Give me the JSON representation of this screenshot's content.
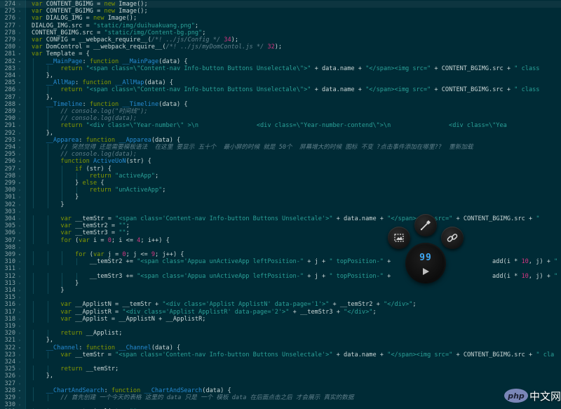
{
  "editor": {
    "lines": [
      {
        "n": "274",
        "code": "var CONTENT_BGIMG = new Image();",
        "current": true
      },
      {
        "n": "275",
        "code": "var CONTENT_BGIMG = new Image();"
      },
      {
        "n": "276",
        "code": "var DIALOG_IMG = new Image();"
      },
      {
        "n": "277",
        "code": "DIALOG_IMG.src = \"static/img/duihuakuang.png\";"
      },
      {
        "n": "278",
        "code": "CONTENT_BGIMG.src = \"static/img/Content-bg.png\";"
      },
      {
        "n": "279",
        "code": "var CONFIG = __webpack_require__(/*! ../js/Config */ 34);"
      },
      {
        "n": "280",
        "code": "var DomControl = __webpack_require__(/*! ../js/myDomContol.js */ 32);"
      },
      {
        "n": "281",
        "code": "var Template = {"
      },
      {
        "n": "282",
        "code": "    __MainPage: function __MainPage(data) {"
      },
      {
        "n": "283",
        "code": "        return \"<span class=\\\"Content-nav Info-button Buttons Unselectale\\\">\" + data.name + \"</span><img src=\" + CONTENT_BGIMG.src + \" class"
      },
      {
        "n": "284",
        "code": "    },"
      },
      {
        "n": "285",
        "code": "    __AllMap: function __AllMap(data) {"
      },
      {
        "n": "286",
        "code": "        return \"<span class=\\\"Content-nav Info-button Buttons Unselectale\\\">\" + data.name + \"</span><img src=\" + CONTENT_BGIMG.src + \" class"
      },
      {
        "n": "287",
        "code": "    },"
      },
      {
        "n": "288",
        "code": "    __Timeline: function __Timeline(data) {"
      },
      {
        "n": "289",
        "code": "        // console.log(\"时间线\");"
      },
      {
        "n": "290",
        "code": "        // console.log(data);"
      },
      {
        "n": "291",
        "code": "        return \"<div class=\\\"Year-number\\\" >\\n                <div class=\\\"Year-number-contend\\\">\\n                <div class=\\\"Yea"
      },
      {
        "n": "292",
        "code": "    },"
      },
      {
        "n": "293",
        "code": "    __Apparea: function __Apparea(data) {"
      },
      {
        "n": "294",
        "code": "        // 突然觉得 还是需要模板语法  在这里 要显示 五十个  最小屏的时候 就是 50个  屏幕增大的时候 图标 不变 ?点击事件添加在哪里??  重新加载"
      },
      {
        "n": "295",
        "code": "        // console.log(data);"
      },
      {
        "n": "296",
        "code": "        function ActiveUoN(str) {"
      },
      {
        "n": "297",
        "code": "            if (str) {"
      },
      {
        "n": "298",
        "code": "                return \"activeApp\";"
      },
      {
        "n": "299",
        "code": "            } else {"
      },
      {
        "n": "300",
        "code": "                return \"unActiveApp\";"
      },
      {
        "n": "301",
        "code": "            }"
      },
      {
        "n": "302",
        "code": "        }"
      },
      {
        "n": "303",
        "code": ""
      },
      {
        "n": "304",
        "code": "        var __temStr = \"<span class='Content-nav Info-button Buttons Unselectale'>\" + data.name + \"</span><img src=\" + CONTENT_BGIMG.src + \""
      },
      {
        "n": "305",
        "code": "        var __temStr2 = \"\";"
      },
      {
        "n": "306",
        "code": "        var __temStr3 = \"\";"
      },
      {
        "n": "307",
        "code": "        for (var i = 0; i <= 4; i++) {"
      },
      {
        "n": "308",
        "code": ""
      },
      {
        "n": "309",
        "code": "            for (var j = 0; j <= 9; j++) {"
      },
      {
        "n": "310",
        "code": "                __temStr2 += \"<span class='Appua unActiveApp leftPosition-\" + j + \" topPosition-\" +"
      },
      {
        "n": "311",
        "code": ""
      },
      {
        "n": "312",
        "code": "                __temStr3 += \"<span class='Appua unActiveApp leftPosition-\" + j + \" topPosition-\" +"
      },
      {
        "n": "313",
        "code": "            }"
      },
      {
        "n": "314",
        "code": "        }"
      },
      {
        "n": "315",
        "code": ""
      },
      {
        "n": "316",
        "code": "        var __ApplistN = __temStr + \"<div class='Applist ApplistN' data-page='1'>\" + __temStr2 + \"</div>\";"
      },
      {
        "n": "317",
        "code": "        var __ApplistR = \"<div class='Applist ApplistR' data-page='2'>\" + __temStr3 + \"</div>\";"
      },
      {
        "n": "318",
        "code": "        var __Applist = __ApplistN + __ApplistR;"
      },
      {
        "n": "319",
        "code": ""
      },
      {
        "n": "320",
        "code": "        return __Applist;"
      },
      {
        "n": "321",
        "code": "    },"
      },
      {
        "n": "322",
        "code": "    __Channel: function __Channel(data) {"
      },
      {
        "n": "323",
        "code": "        var __temStr = \"<span class='Content-nav Info-button Buttons Unselectale'>\" + data.name + \"</span><img src=\" + CONTENT_BGIMG.src + \" cla"
      },
      {
        "n": "324",
        "code": ""
      },
      {
        "n": "325",
        "code": "        return __temStr;"
      },
      {
        "n": "326",
        "code": "    },"
      },
      {
        "n": "327",
        "code": ""
      },
      {
        "n": "328",
        "code": "    __ChartAndSearch: function __ChartAndSearch(data) {"
      },
      {
        "n": "329",
        "code": "        // 首先创建 一个今天的表格 这里的 data 只是 一个 模板 data 在后面点击之后 才会展示 真实的数据"
      },
      {
        "n": "330",
        "code": ""
      },
      {
        "n": "331",
        "code": "        var __temApplist = \"\";"
      },
      {
        "n": "332",
        "code": "        for (var i in data.applist) {"
      }
    ],
    "line_tails": {
      "310": "add(i * 10, j) + \"",
      "312": "add(i * 10, j) + \""
    }
  },
  "radial_menu": {
    "count": "99",
    "buttons": [
      {
        "name": "screenshot-button",
        "icon": "screenshot-icon"
      },
      {
        "name": "color-picker-button",
        "icon": "eyedropper-icon"
      },
      {
        "name": "link-button",
        "icon": "link-icon"
      }
    ],
    "hub_icon": "play-icon"
  },
  "watermark": {
    "text": "中文网",
    "logo_text": "php",
    "colors": {
      "logo": "#7a86b8",
      "text": "#ffffff"
    }
  },
  "theme": {
    "background": "#002b36",
    "gutter": "#073642",
    "keyword": "#859900",
    "string": "#2aa198",
    "function": "#268bd2",
    "comment": "#5f7f8a"
  }
}
